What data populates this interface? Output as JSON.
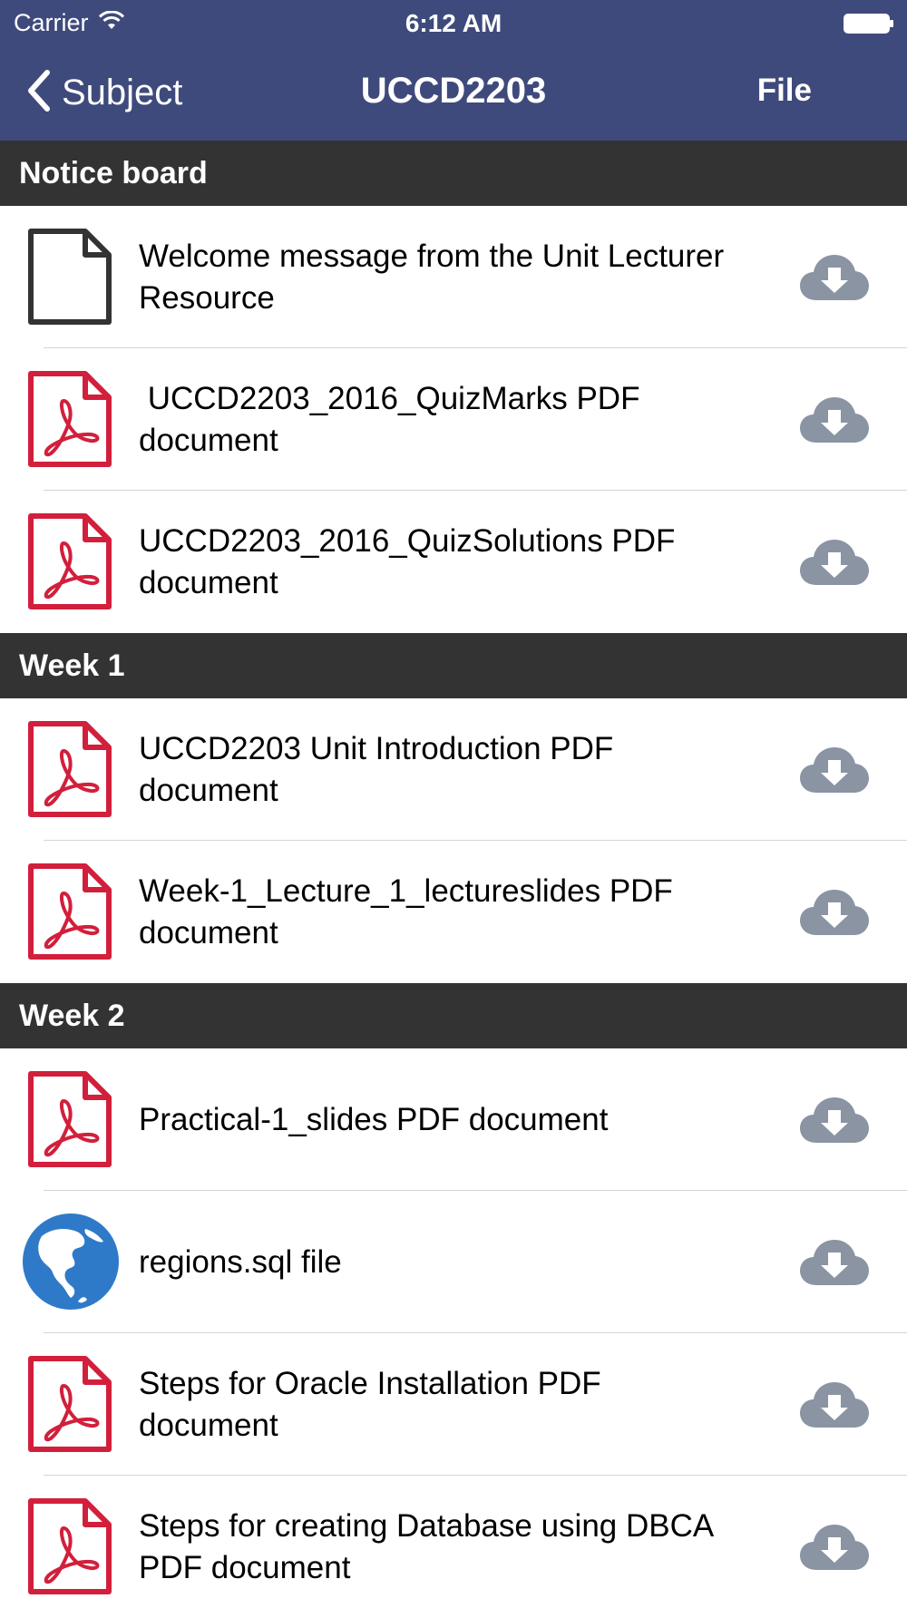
{
  "status_bar": {
    "carrier": "Carrier",
    "time": "6:12 AM"
  },
  "nav": {
    "back_label": "Subject",
    "title": "UCCD2203",
    "right_button": "File"
  },
  "colors": {
    "header_bg": "#3f4a7c",
    "section_bg": "#333333",
    "pdf_red": "#d21f3c",
    "download_gray": "#8a94a3",
    "globe_blue": "#2e7ac8"
  },
  "sections": [
    {
      "title": "Notice board",
      "items": [
        {
          "icon": "document-icon",
          "label": "Welcome message from the Unit Lecturer Resource"
        },
        {
          "icon": "pdf-icon",
          "label": " UCCD2203_2016_QuizMarks PDF document"
        },
        {
          "icon": "pdf-icon",
          "label": "UCCD2203_2016_QuizSolutions PDF document"
        }
      ]
    },
    {
      "title": "Week 1",
      "items": [
        {
          "icon": "pdf-icon",
          "label": "UCCD2203 Unit Introduction PDF document"
        },
        {
          "icon": "pdf-icon",
          "label": "Week-1_Lecture_1_lectureslides PDF document"
        }
      ]
    },
    {
      "title": "Week 2",
      "items": [
        {
          "icon": "pdf-icon",
          "label": "Practical-1_slides PDF document"
        },
        {
          "icon": "globe-icon",
          "label": "regions.sql file"
        },
        {
          "icon": "pdf-icon",
          "label": "Steps for Oracle Installation PDF document"
        },
        {
          "icon": "pdf-icon",
          "label": "Steps for creating Database using DBCA PDF document"
        }
      ]
    }
  ]
}
